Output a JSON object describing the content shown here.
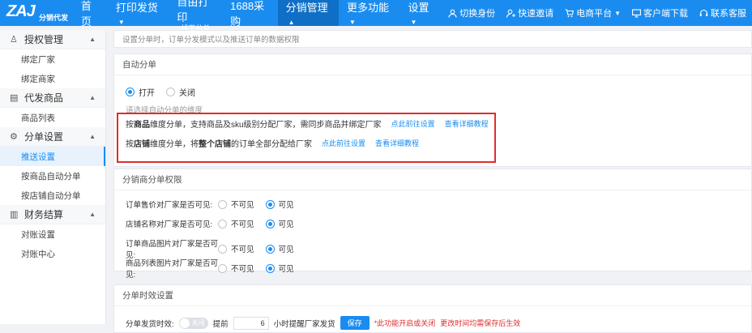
{
  "logo": {
    "text": "ZAJ",
    "sub": "分销代发"
  },
  "nav": {
    "items": [
      {
        "label": "首页"
      },
      {
        "label": "打印发货",
        "caret": "▼"
      },
      {
        "label": "自由打印",
        "sub": "线下分单"
      },
      {
        "label": "1688采购"
      },
      {
        "label": "分销管理",
        "caret": "▲"
      },
      {
        "label": "更多功能",
        "caret": "▼"
      },
      {
        "label": "设置",
        "caret": "▼"
      }
    ],
    "right": [
      {
        "label": "切换身份",
        "icon": "user-icon"
      },
      {
        "label": "快速邀请",
        "icon": "invite-icon"
      },
      {
        "label": "电商平台",
        "icon": "cart-icon",
        "caret": "▼"
      },
      {
        "label": "客户端下载",
        "icon": "monitor-icon"
      },
      {
        "label": "联系客服",
        "icon": "headset-icon"
      }
    ]
  },
  "sidebar": {
    "groups": [
      {
        "label": "授权管理",
        "icon": "auth-icon",
        "items": [
          "绑定厂家",
          "绑定商家"
        ]
      },
      {
        "label": "代发商品",
        "icon": "goods-icon",
        "items": [
          "商品列表"
        ]
      },
      {
        "label": "分单设置",
        "icon": "gear-icon",
        "items": [
          "推送设置",
          "按商品自动分单",
          "按店铺自动分单"
        ]
      },
      {
        "label": "财务结算",
        "icon": "chart-icon",
        "items": [
          "对账设置",
          "对账中心"
        ]
      }
    ]
  },
  "main": {
    "hint": "设置分单时，订单分发模式以及推送订单的数据权限",
    "auto": {
      "title": "自动分单",
      "on_label": "打开",
      "off_label": "关闭",
      "dimension_hint": "请选择自动分单的维度",
      "rows": [
        {
          "pre": "按",
          "bold": "商品",
          "mid": "维度分单，支持商品及sku级别分配厂家，需同步商品并绑定厂家",
          "bold2": "",
          "post": "",
          "link1": "点此前往设置",
          "link2": "查看详细教程"
        },
        {
          "pre": "按",
          "bold": "店铺",
          "mid": "维度分单，将",
          "bold2": "整个店铺",
          "post": "的订单全部分配给厂家",
          "link1": "点此前往设置",
          "link2": "查看详细教程"
        }
      ]
    },
    "perm": {
      "title": "分销商分单权限",
      "rows": [
        {
          "label": "订单售价对厂家是否可见:",
          "value": "可见"
        },
        {
          "label": "店铺名称对厂家是否可见:",
          "value": "可见"
        },
        {
          "label": "订单商品图片对厂家是否可见:",
          "value": "可见"
        },
        {
          "label": "商品列表图片对厂家是否可见:",
          "value": "可见"
        }
      ],
      "opt_hidden": "不可见",
      "opt_visible": "可见"
    },
    "timing": {
      "title": "分单时效设置",
      "label": "分单发货时效:",
      "toggle_text": "关闭",
      "remind_pre": "提前",
      "hours": "6",
      "remind_post": "小时提醒厂家发货",
      "save_label": "保存",
      "warn1": "*此功能开启或关闭",
      "warn2": "更改时间均需保存后生效"
    }
  },
  "colors": {
    "primary": "#1a8cf0",
    "highlight": "#e02c2c"
  }
}
